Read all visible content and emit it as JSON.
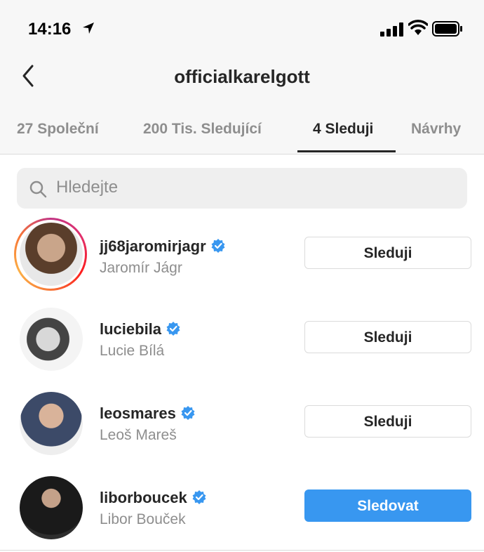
{
  "status_bar": {
    "time": "14:16"
  },
  "header": {
    "title": "officialkarelgott"
  },
  "tabs": [
    {
      "label": "27 Společní",
      "active": false
    },
    {
      "label": "200 Tis. Sledující",
      "active": false
    },
    {
      "label": "4 Sleduji",
      "active": true
    },
    {
      "label": "Návrhy",
      "active": false
    }
  ],
  "search": {
    "placeholder": "Hledejte"
  },
  "users": [
    {
      "username": "jj68jaromirjagr",
      "full_name": "Jaromír Jágr",
      "button": "Sleduji",
      "verified": true,
      "has_story": true
    },
    {
      "username": "luciebila",
      "full_name": "Lucie Bílá",
      "button": "Sleduji",
      "verified": true,
      "has_story": false
    },
    {
      "username": "leosmares",
      "full_name": "Leoš Mareš",
      "button": "Sleduji",
      "verified": true,
      "has_story": false
    },
    {
      "username": "liborboucek",
      "full_name": "Libor Bouček",
      "button": "Sledovat",
      "verified": true,
      "has_story": false
    }
  ],
  "colors": {
    "accent": "#3897f0",
    "verified": "#3897f0",
    "text": "#262626",
    "secondary": "#8e8e8e"
  }
}
